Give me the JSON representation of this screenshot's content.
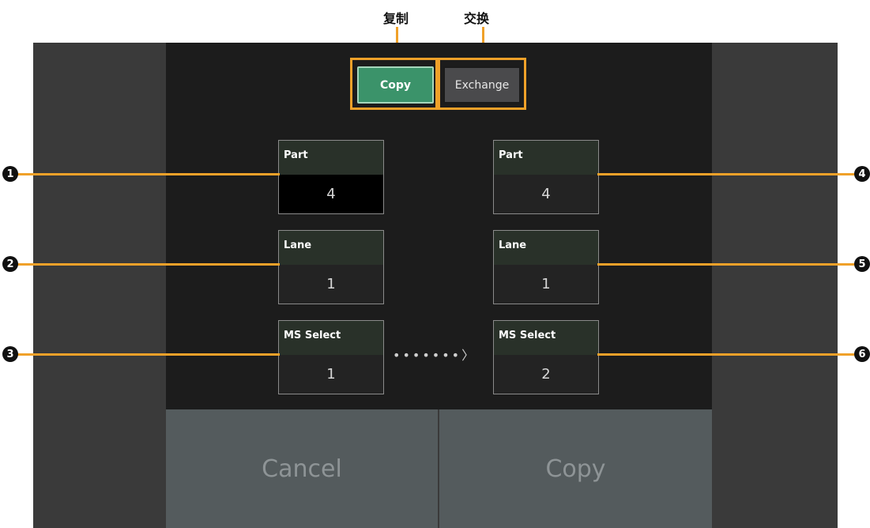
{
  "callouts": {
    "copy": "复制",
    "exchange": "交换"
  },
  "mode_buttons": {
    "copy": "Copy",
    "exchange": "Exchange"
  },
  "source": {
    "part": {
      "label": "Part",
      "value": "4"
    },
    "lane": {
      "label": "Lane",
      "value": "1"
    },
    "ms_select": {
      "label": "MS Select",
      "value": "1"
    }
  },
  "destination": {
    "part": {
      "label": "Part",
      "value": "4"
    },
    "lane": {
      "label": "Lane",
      "value": "1"
    },
    "ms_select": {
      "label": "MS Select",
      "value": "2"
    }
  },
  "arrow": "•••••••〉",
  "actions": {
    "cancel": "Cancel",
    "copy": "Copy"
  },
  "markers": [
    "1",
    "2",
    "3",
    "4",
    "5",
    "6"
  ]
}
